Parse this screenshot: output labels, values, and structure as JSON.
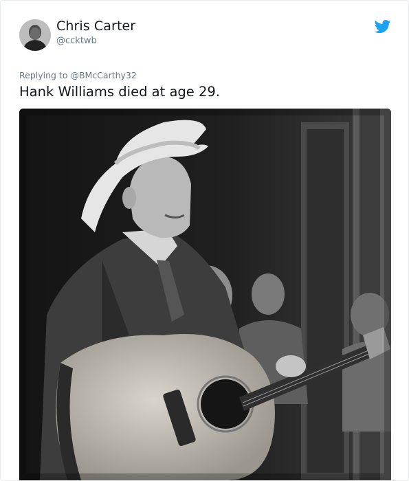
{
  "tweet": {
    "display_name": "Chris Carter",
    "handle": "@ccktwb",
    "reply_prefix": "Replying to ",
    "reply_to": "@BMcCarthy32",
    "text": "Hank Williams died at age 29."
  },
  "icons": {
    "avatar": "profile-photo",
    "logo": "twitter-bird-icon"
  },
  "colors": {
    "twitter_blue": "#1da1f2",
    "name_text": "#14171a",
    "secondary_text": "#657786",
    "border": "#e6ecf0"
  }
}
